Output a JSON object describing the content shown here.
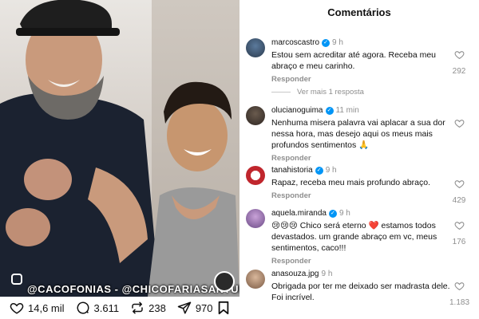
{
  "post": {
    "watermark": "@CACOFONIAS - @CHICOFARIASANTUNES",
    "actions": {
      "likes": "14,6 mil",
      "comments": "3.611",
      "reposts": "238",
      "shares": "970"
    }
  },
  "panel": {
    "title": "Comentários",
    "view_more": "Ver mais 1 resposta",
    "comments": [
      {
        "user": "marcoscastro",
        "verified": true,
        "time": "9 h",
        "text": "Estou sem acreditar até agora. Receba meu abraço e meu carinho.",
        "reply": "Responder",
        "likes": "292"
      },
      {
        "user": "olucianoguima",
        "verified": true,
        "time": "11 min",
        "text": "Nenhuma misera palavra vai aplacar a sua dor nessa hora, mas desejo aqui os meus mais profundos sentimentos 🙏",
        "reply": "Responder",
        "likes": ""
      },
      {
        "user": "tanahistoria",
        "verified": true,
        "time": "9 h",
        "text": "Rapaz, receba meu mais profundo abraço.",
        "reply": "Responder",
        "likes": "429"
      },
      {
        "user": "aquela.miranda",
        "verified": true,
        "time": "9 h",
        "text": "😢😢😢 Chico será eterno ❤️ estamos todos devastados. um grande abraço em vc, meus sentimentos, caco!!!",
        "reply": "Responder",
        "likes": "176"
      },
      {
        "user": "anasouza.jpg",
        "verified": true,
        "time": "9 h",
        "text": "Obrigada por ter me deixado ser madrasta dele. Foi incrível.",
        "reply": "",
        "likes": "1.183"
      }
    ]
  },
  "colors": {
    "verified": "#0095f6",
    "muted": "#8e8e8e",
    "text": "#111111"
  },
  "icons": {
    "like": "heart-icon",
    "comment": "comment-bubble-icon",
    "repost": "repost-icon",
    "share": "paper-plane-icon",
    "save": "bookmark-icon"
  }
}
